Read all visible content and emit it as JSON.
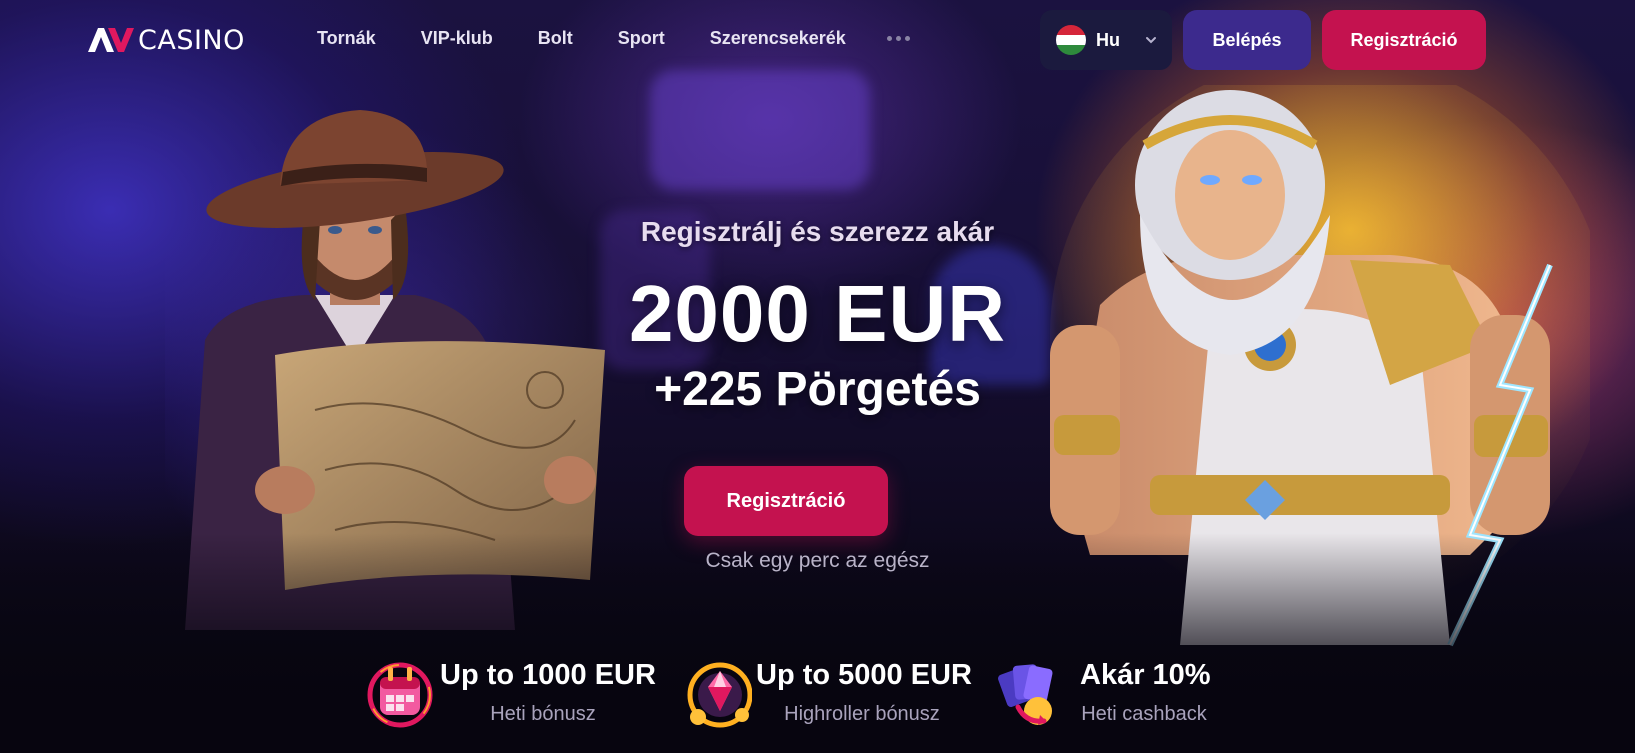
{
  "header": {
    "logo_text": "CASINO",
    "nav": [
      {
        "label": "Tornák"
      },
      {
        "label": "VIP-klub"
      },
      {
        "label": "Bolt"
      },
      {
        "label": "Sport"
      },
      {
        "label": "Szerencsekerék"
      }
    ],
    "language": {
      "label": "Hu",
      "flag": "hungary-flag-icon"
    },
    "login_label": "Belépés",
    "register_label": "Regisztráció"
  },
  "promo": {
    "lead": "Regisztrálj és szerezz akár",
    "amount": "2000 EUR",
    "spins": "+225 Pörgetés",
    "cta_label": "Regisztráció",
    "note": "Csak egy perc az egész"
  },
  "benefits": [
    {
      "title": "Up to 1000 EUR",
      "subtitle": "Heti bónusz",
      "icon": "calendar-gift-icon"
    },
    {
      "title": "Up to 5000 EUR",
      "subtitle": "Highroller bónusz",
      "icon": "gem-coins-icon"
    },
    {
      "title": "Akár 10%",
      "subtitle": "Heti cashback",
      "icon": "cards-cashback-icon"
    }
  ],
  "colors": {
    "accent": "#c4124f",
    "login_button": "#3c2a8d",
    "language_button": "#1b1a3e",
    "background": "#0b0716"
  }
}
